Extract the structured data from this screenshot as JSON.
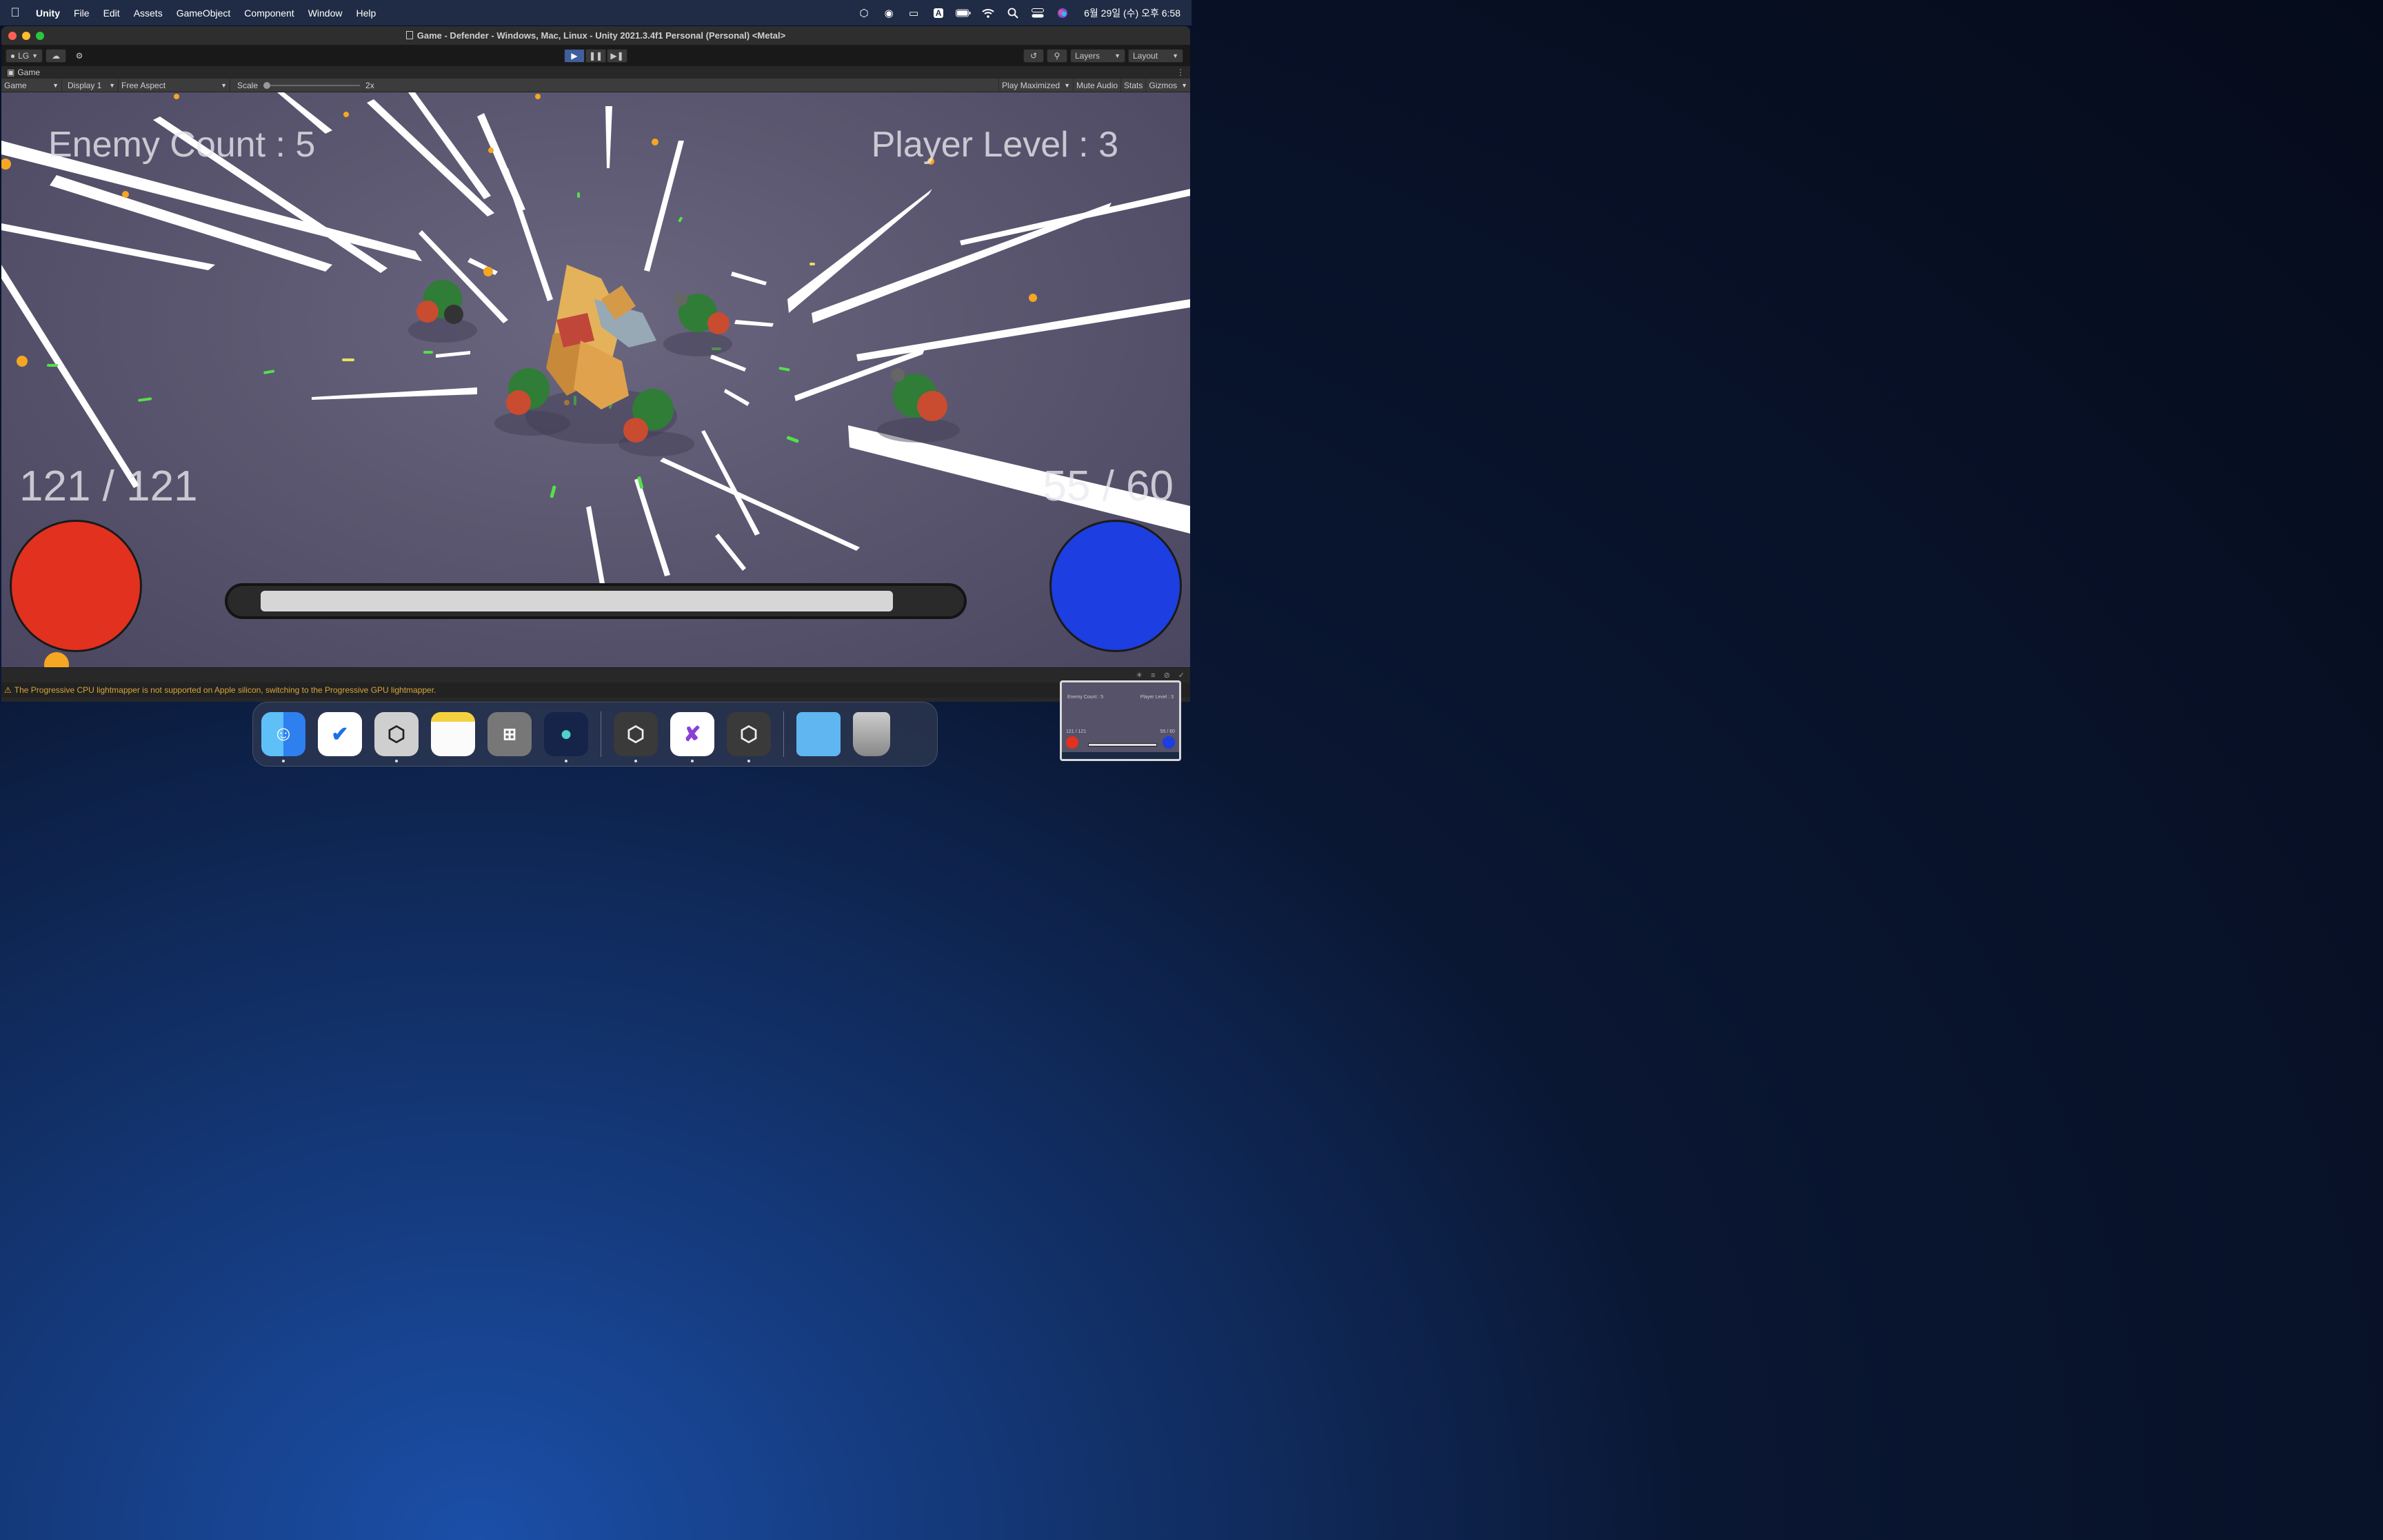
{
  "menubar": {
    "app_name": "Unity",
    "items": [
      "File",
      "Edit",
      "Assets",
      "GameObject",
      "Component",
      "Window",
      "Help"
    ],
    "status_icons": [
      "unity-hub-icon",
      "steam-icon",
      "display-icon",
      "input-source-icon",
      "battery-icon",
      "wifi-icon",
      "spotlight-icon",
      "control-center-icon",
      "siri-icon"
    ],
    "input_source": "A",
    "clock": "6월 29일 (수) 오후 6:58"
  },
  "window": {
    "title": "Game - Defender - Windows, Mac, Linux - Unity 2021.3.4f1 Personal (Personal) <Metal>"
  },
  "toolbar": {
    "account": "LG",
    "layers_label": "Layers",
    "layout_label": "Layout"
  },
  "game_tab": {
    "label": "Game",
    "view_select": "Game",
    "display_select": "Display 1",
    "aspect_select": "Free Aspect",
    "scale_label": "Scale",
    "scale_value": "2x",
    "play_maximized": "Play Maximized",
    "mute_audio": "Mute Audio",
    "stats": "Stats",
    "gizmos": "Gizmos"
  },
  "hud": {
    "enemy_count": "Enemy Count : 5",
    "player_level": "Player Level : 3",
    "hp": "121 / 121",
    "mp": "55 / 60",
    "exp_fraction": 0.94,
    "hp_color": "#e2311f",
    "mp_color": "#1d3ee0"
  },
  "console": {
    "message": "The Progressive CPU lightmapper is not supported on Apple silicon, switching to the Progressive GPU lightmapper."
  },
  "dock": {
    "apps": [
      "Finder",
      "Tasks",
      "Unity Hub",
      "Notes",
      "Calculator",
      "Whale",
      "Unity",
      "Visual Studio",
      "Unity",
      "Folder",
      "Trash"
    ]
  },
  "thumbnail": {
    "enemy_count": "Enemy Count : 5",
    "player_level": "Player Level : 3",
    "hp": "121 / 121",
    "mp": "55 / 60"
  }
}
